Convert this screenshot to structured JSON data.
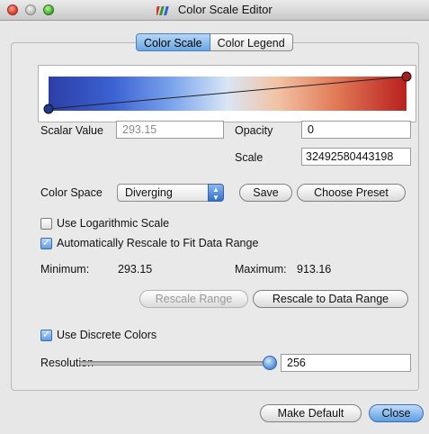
{
  "window": {
    "title": "Color Scale Editor"
  },
  "tabs": [
    {
      "label": "Color Scale",
      "active": true
    },
    {
      "label": "Color Legend",
      "active": false
    }
  ],
  "scale": {
    "scalar_value_label": "Scalar Value",
    "scalar_value": "293.15",
    "opacity_label": "Opacity",
    "opacity_value": "0",
    "scale_label": "Scale",
    "scale_value": "32492580443198",
    "gradient_colors": [
      "#2c3fa6",
      "#3c62d3",
      "#78a2ec",
      "#d9e6f5",
      "#f2c2a4",
      "#e27b58",
      "#b9201e"
    ]
  },
  "color_space": {
    "label": "Color Space",
    "value": "Diverging",
    "save_label": "Save",
    "choose_preset_label": "Choose Preset"
  },
  "options": {
    "log_scale_label": "Use Logarithmic Scale",
    "log_scale_checked": false,
    "auto_rescale_label": "Automatically Rescale to Fit Data Range",
    "auto_rescale_checked": true
  },
  "range": {
    "minimum_label": "Minimum:",
    "minimum_value": "293.15",
    "maximum_label": "Maximum:",
    "maximum_value": "913.16",
    "rescale_range_label": "Rescale Range",
    "rescale_to_data_label": "Rescale to Data Range"
  },
  "discrete": {
    "label": "Use Discrete Colors",
    "checked": true,
    "resolution_label": "Resolution",
    "resolution_value": "256"
  },
  "footer": {
    "make_default_label": "Make Default",
    "close_label": "Close"
  }
}
